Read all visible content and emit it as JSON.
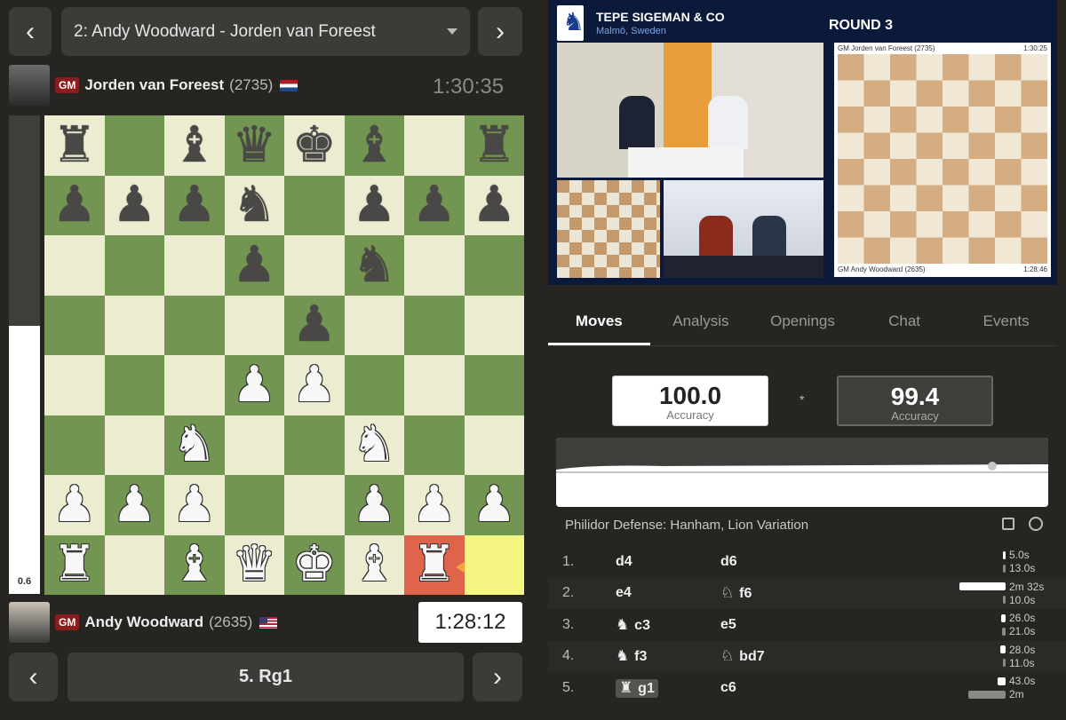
{
  "game_selector": {
    "label": "2: Andy Woodward - Jorden van Foreest"
  },
  "top_player": {
    "title": "GM",
    "name": "Jorden van Foreest",
    "rating": "(2735)",
    "clock": "1:30:35",
    "flag": "netherlands-flag"
  },
  "bottom_player": {
    "title": "GM",
    "name": "Andy Woodward",
    "rating": "(2635)",
    "clock": "1:28:12",
    "flag": "usa-flag"
  },
  "eval": {
    "value": "0.6",
    "white_fraction": 0.56
  },
  "board": {
    "ranks": [
      [
        "r",
        "",
        "b",
        "q",
        "k",
        "b",
        "",
        "r"
      ],
      [
        "p",
        "p",
        "p",
        "n",
        "",
        "p",
        "p",
        "p"
      ],
      [
        "",
        "",
        "",
        "p",
        "",
        "n",
        "",
        ""
      ],
      [
        "",
        "",
        "",
        "",
        "p",
        "",
        "",
        ""
      ],
      [
        "",
        "",
        "",
        "P",
        "P",
        "",
        "",
        ""
      ],
      [
        "",
        "",
        "N",
        "",
        "",
        "N",
        "",
        ""
      ],
      [
        "P",
        "P",
        "P",
        "",
        "",
        "P",
        "P",
        "P"
      ],
      [
        "R",
        "",
        "B",
        "Q",
        "K",
        "B",
        "R",
        ""
      ]
    ],
    "highlight_from": "h1",
    "highlight_to": "g1"
  },
  "current_move": "5. Rg1",
  "video": {
    "event": "TEPE SIGEMAN & CO",
    "location": "Malmö, Sweden",
    "round": "ROUND 3",
    "overlay_top_player": "GM Jorden van Foreest (2735)",
    "overlay_top_clock": "1:30:25",
    "overlay_bottom_player": "GM Andy Woodward (2635)",
    "overlay_bottom_clock": "1:28:46"
  },
  "tabs": [
    "Moves",
    "Analysis",
    "Openings",
    "Chat",
    "Events"
  ],
  "active_tab": "Moves",
  "accuracy": {
    "white": {
      "value": "100.0",
      "label": "Accuracy"
    },
    "separator": "*",
    "black": {
      "value": "99.4",
      "label": "Accuracy"
    }
  },
  "opening": "Philidor Defense: Hanham, Lion Variation",
  "moves": [
    {
      "no": "1.",
      "white": "d4",
      "white_icon": "",
      "black": "d6",
      "black_icon": "",
      "wt": "5.0s",
      "bt": "13.0s",
      "wt_frac": 0.02,
      "bt_frac": 0.05
    },
    {
      "no": "2.",
      "white": "e4",
      "white_icon": "",
      "black": "f6",
      "black_icon": "♘",
      "wt": "2m 32s",
      "bt": "10.0s",
      "wt_frac": 1.0,
      "bt_frac": 0.04
    },
    {
      "no": "3.",
      "white": "c3",
      "white_icon": "♞",
      "black": "e5",
      "black_icon": "",
      "wt": "26.0s",
      "bt": "21.0s",
      "wt_frac": 0.1,
      "bt_frac": 0.08
    },
    {
      "no": "4.",
      "white": "f3",
      "white_icon": "♞",
      "black": "bd7",
      "black_icon": "♘",
      "wt": "28.0s",
      "bt": "11.0s",
      "wt_frac": 0.11,
      "bt_frac": 0.04
    },
    {
      "no": "5.",
      "white": "g1",
      "white_icon": "♜",
      "black": "c6",
      "black_icon": "",
      "wt": "43.0s",
      "bt": "2m",
      "wt_frac": 0.17,
      "bt_frac": 0.8
    }
  ],
  "colors": {
    "light_square": "#ebecd0",
    "dark_square": "#739552",
    "highlight": "#f5f682",
    "last_move": "#e0634c",
    "arrow": "#f3a43c"
  }
}
